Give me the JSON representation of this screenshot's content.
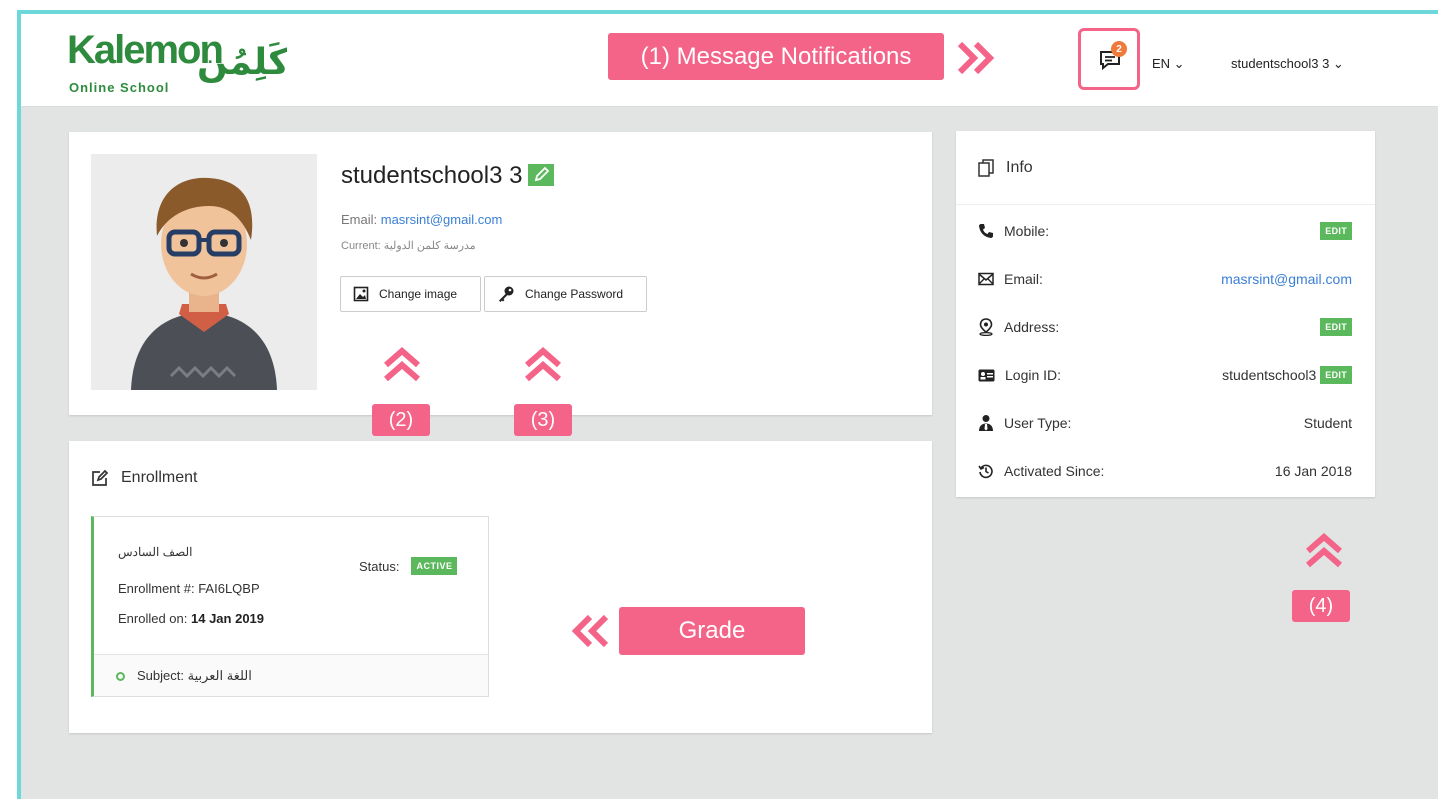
{
  "logo": {
    "latin": "Kalemon",
    "subtitle": "Online School",
    "arabic": "كَلِمُن"
  },
  "header": {
    "notification_count": "2",
    "language": "EN ⌄",
    "user_menu": "studentschool3 3 ⌄"
  },
  "annotations": {
    "messages": "(1) Message Notifications",
    "change_image": "(2)",
    "change_password": "(3)",
    "info": "(4)",
    "grade": "Grade"
  },
  "profile": {
    "name": "studentschool3 3",
    "email_label": "Email: ",
    "email": "masrsint@gmail.com",
    "current": "Current: مدرسة كلمن الدولية",
    "change_image_label": "Change image",
    "change_password_label": "Change Password"
  },
  "enrollment": {
    "title": "Enrollment",
    "grade": "الصف السادس",
    "status_label": "Status:",
    "status": "ACTIVE",
    "number": "Enrollment #: FAI6LQBP",
    "enrolled_label": "Enrolled on: ",
    "enrolled_date": "14 Jan 2019",
    "subject": "Subject: اللغة العربية"
  },
  "info": {
    "title": "Info",
    "rows": [
      {
        "label": "Mobile:",
        "value": "",
        "edit": "EDIT"
      },
      {
        "label": "Email:",
        "value": "masrsint@gmail.com",
        "edit": ""
      },
      {
        "label": "Address:",
        "value": "",
        "edit": "EDIT"
      },
      {
        "label": "Login ID:",
        "value": "studentschool3",
        "edit": "EDIT"
      },
      {
        "label": "User Type:",
        "value": "Student",
        "edit": ""
      },
      {
        "label": "Activated Since:",
        "value": "16 Jan 2018",
        "edit": ""
      }
    ]
  },
  "colors": {
    "accent": "#f46488",
    "green": "#5cb85c",
    "link": "#3a7fd5",
    "frame": "#6dd8dc"
  }
}
